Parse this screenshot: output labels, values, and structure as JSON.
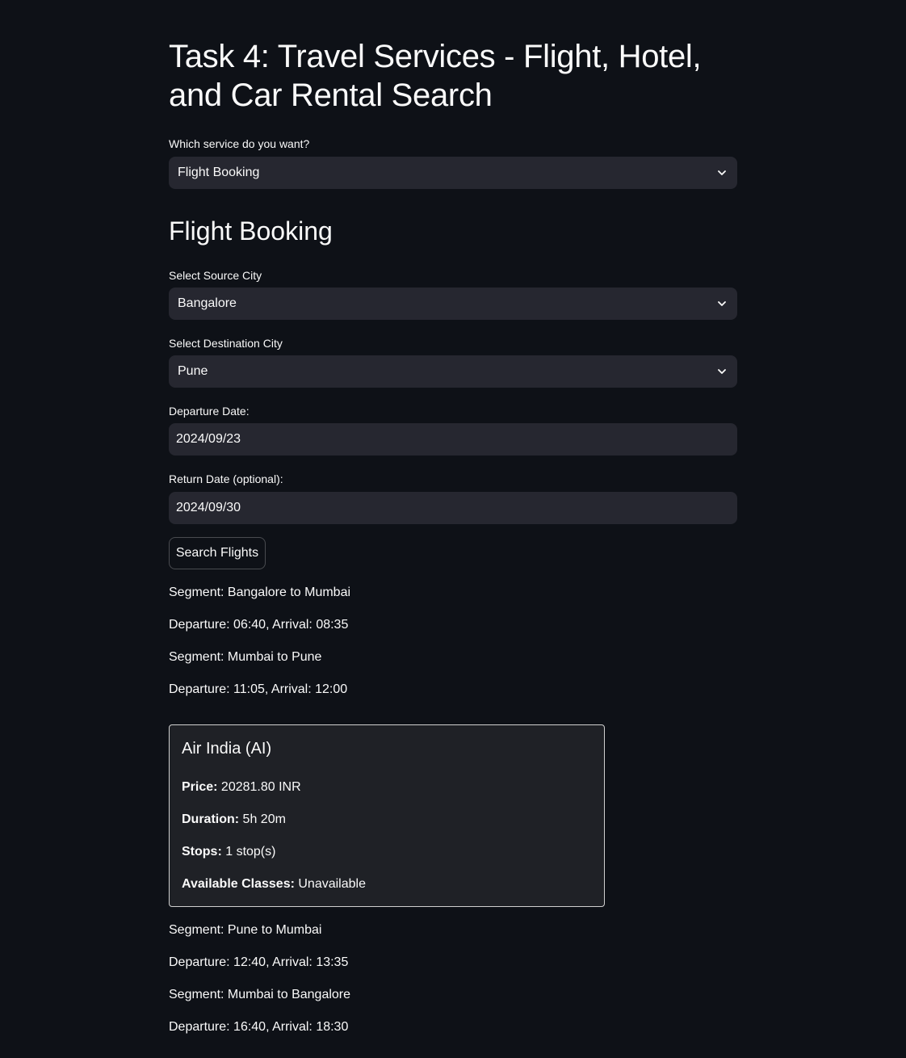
{
  "page": {
    "title": "Task 4: Travel Services - Flight, Hotel, and Car Rental Search"
  },
  "service_select": {
    "label": "Which service do you want?",
    "value": "Flight Booking"
  },
  "section_title": "Flight Booking",
  "source_city": {
    "label": "Select Source City",
    "value": "Bangalore"
  },
  "destination_city": {
    "label": "Select Destination City",
    "value": "Pune"
  },
  "departure_date": {
    "label": "Departure Date:",
    "value": "2024/09/23"
  },
  "return_date": {
    "label": "Return Date (optional):",
    "value": "2024/09/30"
  },
  "search_button": {
    "label": "Search Flights"
  },
  "outbound_segments": [
    {
      "segment": "Segment: Bangalore to Mumbai",
      "times": "Departure: 06:40, Arrival: 08:35"
    },
    {
      "segment": "Segment: Mumbai to Pune",
      "times": "Departure: 11:05, Arrival: 12:00"
    }
  ],
  "flight_card": {
    "airline": "Air India (AI)",
    "price_label": "Price:",
    "price_value": "20281.80 INR",
    "duration_label": "Duration:",
    "duration_value": "5h 20m",
    "stops_label": "Stops:",
    "stops_value": "1 stop(s)",
    "classes_label": "Available Classes:",
    "classes_value": "Unavailable"
  },
  "return_segments": [
    {
      "segment": "Segment: Pune to Mumbai",
      "times": "Departure: 12:40, Arrival: 13:35"
    },
    {
      "segment": "Segment: Mumbai to Bangalore",
      "times": "Departure: 16:40, Arrival: 18:30"
    }
  ],
  "icons": {
    "dropdown": "chevron-down-icon"
  },
  "colors": {
    "background": "#0e1117",
    "input_background": "#262730",
    "card_background": "#1f2126",
    "text": "#fafafa"
  }
}
